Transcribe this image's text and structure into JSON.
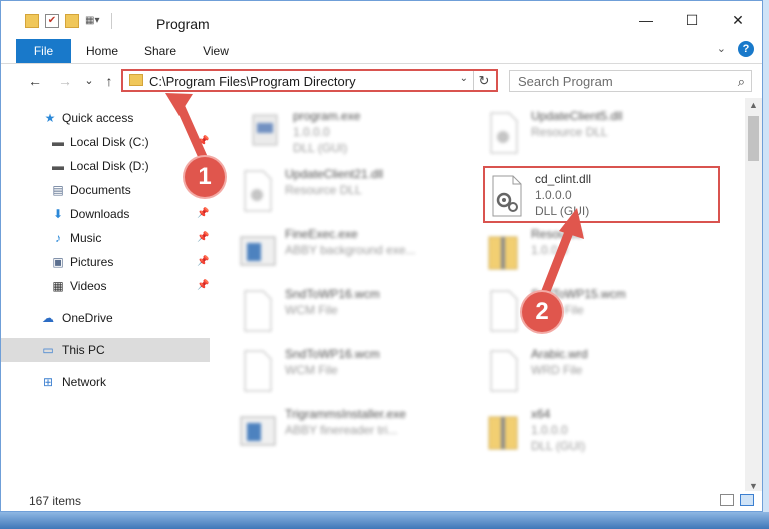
{
  "window": {
    "title": "Program",
    "controls": {
      "minimize": "—",
      "maximize": "☐",
      "close": "✕"
    }
  },
  "ribbon": {
    "tabs": [
      "File",
      "Home",
      "Share",
      "View"
    ],
    "help": "?"
  },
  "navbar": {
    "back": "←",
    "forward": "→",
    "recent": "⌄",
    "up": "↑",
    "address": "C:\\Program Files\\Program Directory",
    "address_dropdown": "⌄",
    "refresh": "↻",
    "search_placeholder": "Search Program",
    "search_icon": "⌕"
  },
  "sidebar": {
    "items": [
      {
        "label": "Quick access",
        "icon": "star-icon",
        "glyph": "★",
        "color": "#2b88d8"
      },
      {
        "label": "Local Disk (C:)",
        "icon": "drive-icon",
        "glyph": "▬",
        "color": "#555555",
        "pinned": true
      },
      {
        "label": "Local Disk (D:)",
        "icon": "drive-icon",
        "glyph": "▬",
        "color": "#555555"
      },
      {
        "label": "Documents",
        "icon": "document-icon",
        "glyph": "▤",
        "color": "#5b6f8f"
      },
      {
        "label": "Downloads",
        "icon": "download-icon",
        "glyph": "⬇",
        "color": "#2b88d8",
        "pinned": true
      },
      {
        "label": "Music",
        "icon": "music-icon",
        "glyph": "♪",
        "color": "#2b88d8",
        "pinned": true
      },
      {
        "label": "Pictures",
        "icon": "pictures-icon",
        "glyph": "▣",
        "color": "#5b6f8f",
        "pinned": true
      },
      {
        "label": "Videos",
        "icon": "videos-icon",
        "glyph": "▦",
        "color": "#333333",
        "pinned": true
      },
      {
        "label": "OneDrive",
        "icon": "cloud-icon",
        "glyph": "☁",
        "color": "#2b6cc4"
      },
      {
        "label": "This PC",
        "icon": "computer-icon",
        "glyph": "▭",
        "color": "#3c7fd0",
        "selected": true
      },
      {
        "label": "Network",
        "icon": "network-icon",
        "glyph": "⊞",
        "color": "#3c7fd0"
      }
    ],
    "pin_glyph": "📌"
  },
  "files": [
    {
      "name": "program.exe",
      "line2": "1.0.0.0",
      "line3": "DLL (GUI)",
      "icon": "exe-icon"
    },
    {
      "name": "UpdateClient5.dll",
      "line2": "Resource DLL",
      "line3": "",
      "icon": "dll-icon"
    },
    {
      "name": "UpdateClient21.dll",
      "line2": "Resource DLL",
      "line3": "",
      "icon": "dll-icon"
    },
    {
      "name": "cd_clint.dll",
      "line2": "1.0.0.0",
      "line3": "DLL (GUI)",
      "icon": "dll-gear-icon",
      "highlighted": true
    },
    {
      "name": "FineExec.exe",
      "line2": "ABBY background exe...",
      "line3": "",
      "icon": "app-icon"
    },
    {
      "name": "Resource",
      "line2": "1.0.0.0",
      "line3": "",
      "icon": "folder-zip-icon"
    },
    {
      "name": "SndToWP16.wcm",
      "line2": "WCM File",
      "line3": "",
      "icon": "file-icon"
    },
    {
      "name": "SndToWP15.wcm",
      "line2": "WCM File",
      "line3": "",
      "icon": "file-icon"
    },
    {
      "name": "SndToWP16.wcm",
      "line2": "WCM File",
      "line3": "",
      "icon": "file-icon"
    },
    {
      "name": "Arabic.wrd",
      "line2": "WRD File",
      "line3": "",
      "icon": "file-icon"
    },
    {
      "name": "TrigrammsInstaller.exe",
      "line2": "ABBY finereader tri...",
      "line3": "",
      "icon": "app-icon"
    },
    {
      "name": "x64",
      "line2": "1.0.0.0",
      "line3": "DLL (GUI)",
      "icon": "folder-zip-icon"
    }
  ],
  "status": {
    "items": "167 items"
  },
  "annotations": {
    "step1": "1",
    "step2": "2",
    "color": "#e0564d"
  }
}
